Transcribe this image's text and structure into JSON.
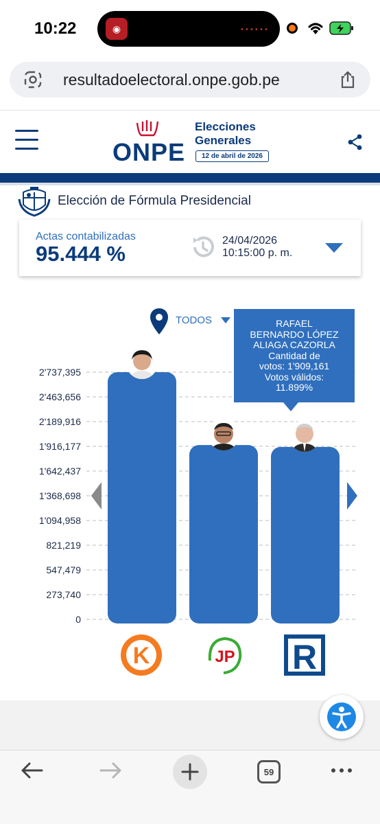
{
  "status_bar": {
    "time": "10:22",
    "island_dots": "••••••"
  },
  "browser": {
    "url": "resultadoelectoral.onpe.gob.pe",
    "tabs_count": "59"
  },
  "header": {
    "logo_text": "ONPE",
    "title_line1": "Elecciones",
    "title_line2": "Generales",
    "date_badge": "12 de abril de 2026"
  },
  "section": {
    "title": "Elección de Fórmula Presidencial"
  },
  "actas": {
    "label": "Actas contabilizadas",
    "value": "95.444 %",
    "date": "24/04/2026",
    "time": "10:15:00 p. m."
  },
  "filter": {
    "label": "TODOS"
  },
  "tooltip": {
    "lines": [
      "RAFAEL",
      "BERNARDO LÓPEZ",
      "ALIAGA CAZORLA",
      "Cantidad de",
      "votos: 1'909,161",
      "Votos válidos:",
      "11.899%"
    ]
  },
  "chart_data": {
    "type": "bar",
    "title": "",
    "xlabel": "",
    "ylabel": "",
    "ylim": [
      0,
      2737395
    ],
    "y_ticks": [
      "2'737,395",
      "2'463,656",
      "2'189,916",
      "1'916,177",
      "1'642,437",
      "1'368,698",
      "1'094,958",
      "821,219",
      "547,479",
      "273,740",
      "0"
    ],
    "y_tick_values": [
      2737395,
      2463656,
      2189916,
      1916177,
      1642437,
      1368698,
      1094958,
      821219,
      547479,
      273740,
      0
    ],
    "categories": [
      "Fuerza Popular",
      "Juntos por el Perú",
      "Renovación Popular"
    ],
    "values": [
      2737395,
      1930000,
      1909161
    ],
    "bar_color": "#2f6fbd",
    "party_logo_letters": [
      "K",
      "JP",
      "R"
    ]
  },
  "colors": {
    "primary": "#0b3b7a",
    "accent": "#2f6fbd",
    "logo_red": "#c8102e"
  },
  "icons": {
    "menu": "menu-icon",
    "share": "share-icon",
    "clock": "clock-icon",
    "pin": "location-pin-icon",
    "accessibility": "accessibility-icon"
  }
}
